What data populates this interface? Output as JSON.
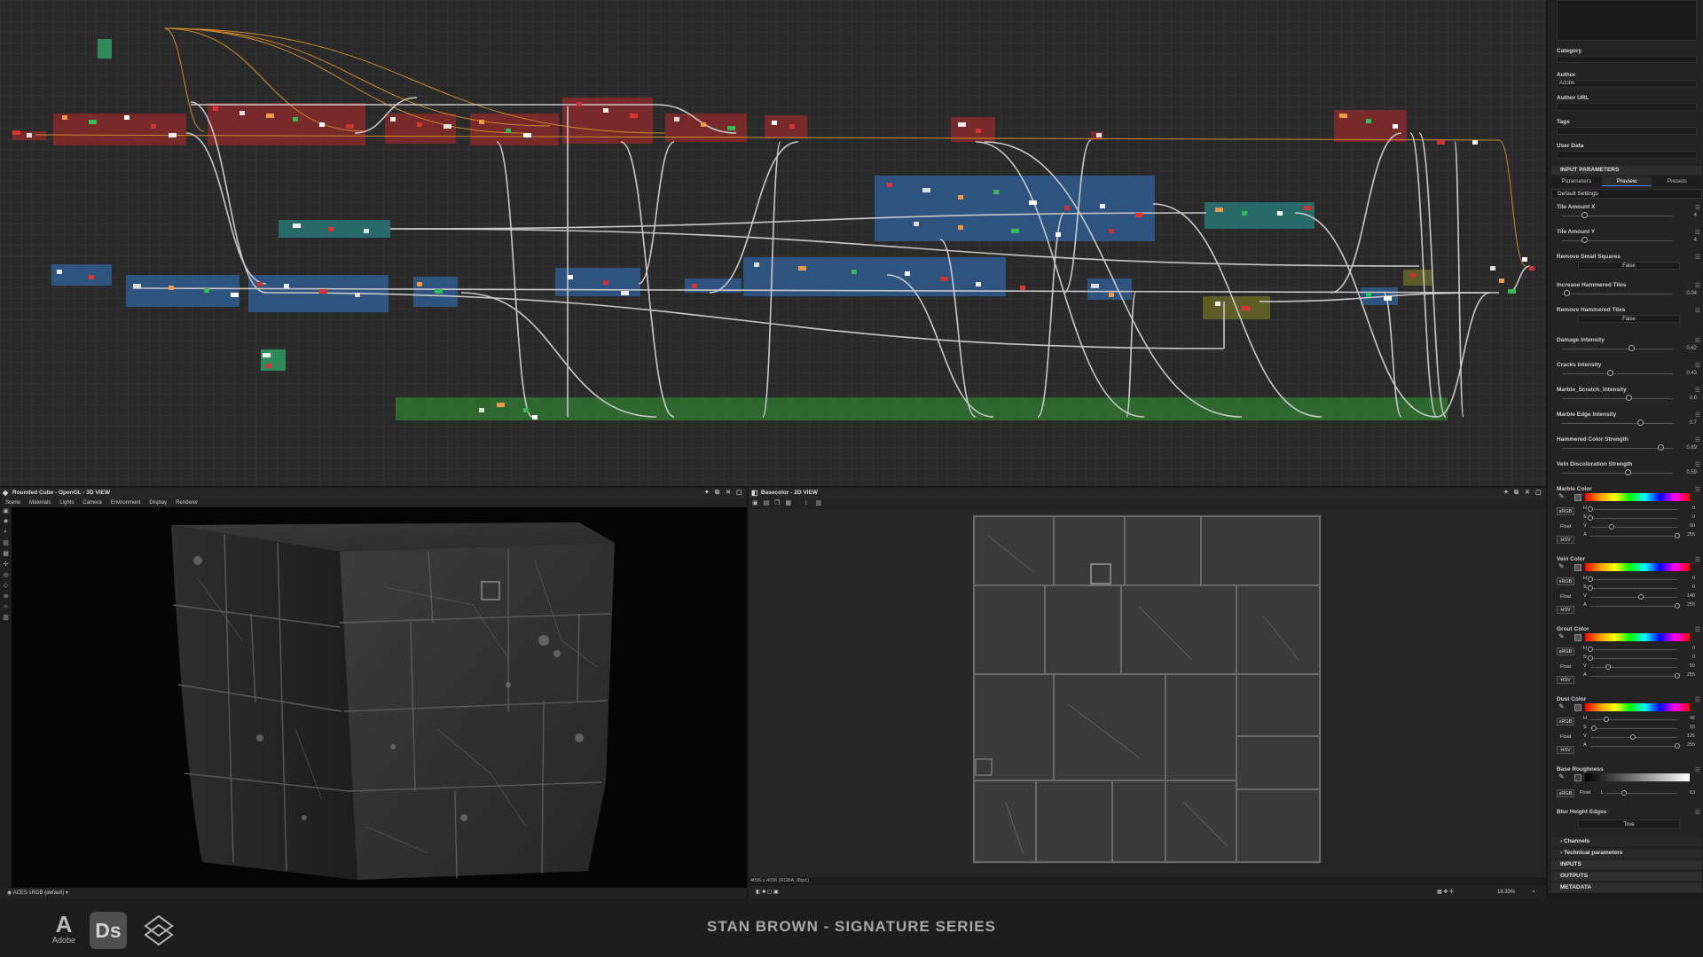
{
  "view3d": {
    "title": "Rounded Cube - OpenGL - 3D VIEW",
    "menu": [
      "Scene",
      "Materials",
      "Lights",
      "Camera",
      "Environment",
      "Display",
      "Renderer"
    ],
    "colorspace": "ACES sRGB (default)"
  },
  "view2d": {
    "title": "Basecolor - 2D VIEW",
    "info": "4096 x 4096 (RGBA, 8bpc)",
    "zoom": "18.33%"
  },
  "panel": {
    "category_label": "Category",
    "author_label": "Author",
    "author_value": "Adobe",
    "author_url_label": "Author URL",
    "tags_label": "Tags",
    "user_data_label": "User Data",
    "section_input": "INPUT PARAMETERS",
    "tabs": [
      "Parameters",
      "Preview",
      "Presets"
    ],
    "preset": "Default Settings",
    "params": [
      {
        "name": "Tile Amount X",
        "value": "4",
        "frac": 0.2
      },
      {
        "name": "Tile Amount Y",
        "value": "4",
        "frac": 0.2
      },
      {
        "name": "Remove Small Squares",
        "value": "False",
        "type": "bool"
      },
      {
        "name": "Increase Hammered Tiles",
        "value": "0.04",
        "frac": 0.04
      },
      {
        "name": "Remove Hammered Tiles",
        "value": "False",
        "type": "bool"
      },
      {
        "name": "Damage Intensity",
        "value": "0.62",
        "frac": 0.62
      },
      {
        "name": "Cracks Intensity",
        "value": "0.43",
        "frac": 0.43
      },
      {
        "name": "Marble_Scratch_Intensity",
        "value": "0.6",
        "frac": 0.6
      },
      {
        "name": "Marble Edge Intensity",
        "value": "0.7",
        "frac": 0.7
      },
      {
        "name": "Hammered Color Strength",
        "value": "0.89",
        "frac": 0.89
      },
      {
        "name": "Vein Discoloration Strength",
        "value": "0.59",
        "frac": 0.59
      }
    ],
    "colors": [
      {
        "name": "Marble Color",
        "H": "0",
        "S": "0",
        "V": "60",
        "A": "255",
        "hf": 0,
        "sf": 0,
        "vf": 0.24
      },
      {
        "name": "Vein Color",
        "H": "0",
        "S": "0",
        "V": "148",
        "A": "255",
        "hf": 0,
        "sf": 0,
        "vf": 0.58
      },
      {
        "name": "Grout Color",
        "H": "0",
        "S": "0",
        "V": "50",
        "A": "255",
        "hf": 0,
        "sf": 0,
        "vf": 0.2
      },
      {
        "name": "Dust Color",
        "H": "46",
        "S": "10",
        "V": "125",
        "A": "255",
        "hf": 0.18,
        "sf": 0.04,
        "vf": 0.49
      }
    ],
    "roughness": {
      "name": "Base Roughness",
      "value": "63",
      "frac": 0.25
    },
    "blur": {
      "name": "Blur Height Edges",
      "value": "True"
    },
    "sub_sections": [
      "Channels",
      "Technical parameters"
    ],
    "sections": [
      "INPUTS",
      "OUTPUTS",
      "METADATA"
    ],
    "labels": {
      "srgb": "sRGB",
      "float": "Float",
      "hsv": "HSV",
      "h": "H",
      "s": "S",
      "v": "V",
      "a": "A",
      "l": "L"
    }
  },
  "brand": {
    "adobe": "Adobe",
    "ds": "Ds",
    "title": "STAN BROWN - SIGNATURE SERIES"
  },
  "colors": {
    "frame_red": "#8e2a2a",
    "frame_blue": "#2f5f96",
    "frame_teal": "#277c7a",
    "frame_green": "#2f7a2f",
    "wire": "#c8c8c8",
    "wire_orange": "#d08a2a"
  }
}
